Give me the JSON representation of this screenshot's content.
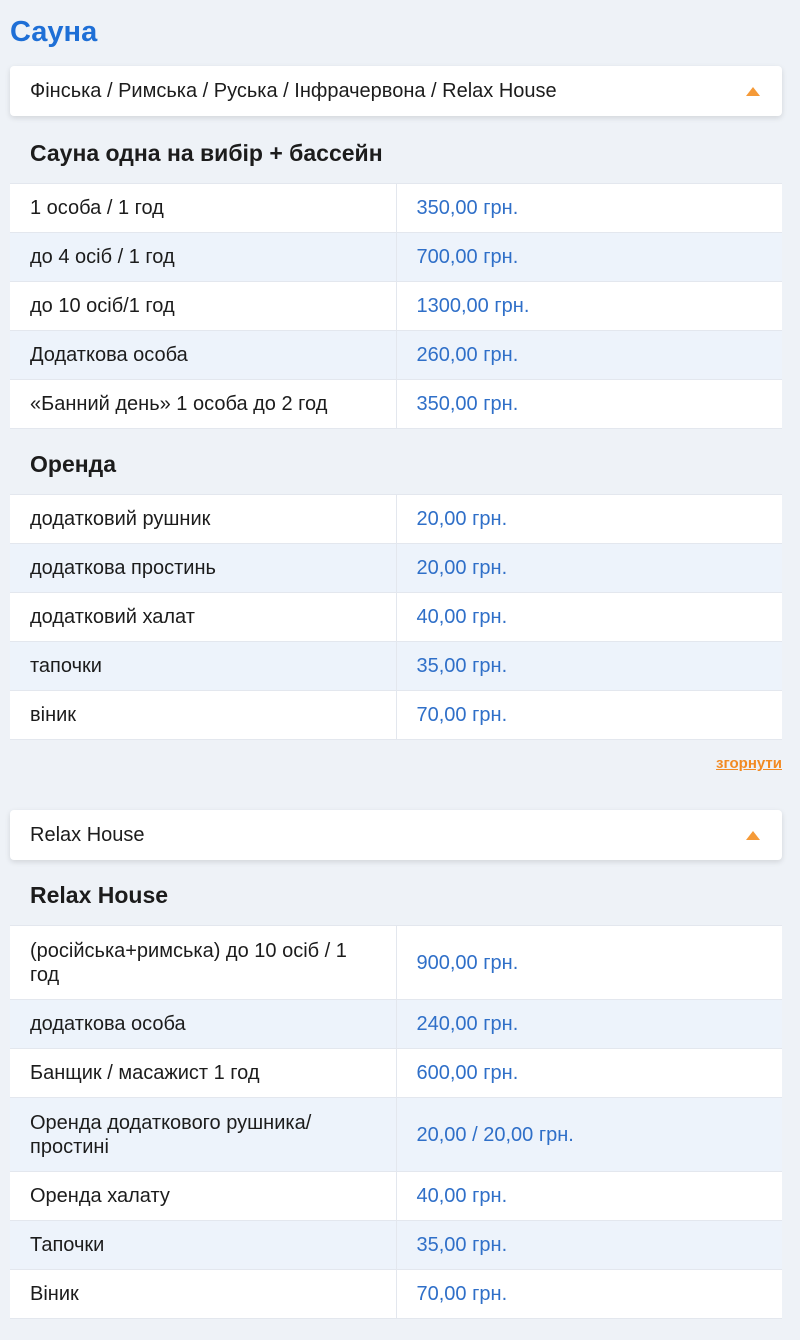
{
  "page": {
    "title": "Сауна"
  },
  "accordion1": {
    "title": "Фінська / Римська / Руська / Інфрачервона / Relax House",
    "icon": "chevron-up-icon",
    "groups": [
      {
        "heading": "Сауна одна на вибір + бассейн",
        "rows": [
          {
            "name": "1 особа / 1 год",
            "price": "350,00 грн."
          },
          {
            "name": "до 4 осіб / 1 год",
            "price": "700,00 грн."
          },
          {
            "name": "до 10 осіб/1 год",
            "price": "1300,00 грн."
          },
          {
            "name": "Додаткова особа",
            "price": "260,00 грн."
          },
          {
            "name": "«Банний день» 1 особа до 2 год",
            "price": "350,00 грн."
          }
        ]
      },
      {
        "heading": "Оренда",
        "rows": [
          {
            "name": "додатковий рушник",
            "price": "20,00 грн."
          },
          {
            "name": "додаткова простинь",
            "price": "20,00 грн."
          },
          {
            "name": "додатковий халат",
            "price": "40,00 грн."
          },
          {
            "name": "тапочки",
            "price": "35,00 грн."
          },
          {
            "name": "віник",
            "price": "70,00 грн."
          }
        ]
      }
    ],
    "collapse_label": "згорнути"
  },
  "accordion2": {
    "title": "Relax House",
    "icon": "chevron-up-icon",
    "groups": [
      {
        "heading": "Relax House",
        "rows": [
          {
            "name": "(російська+римська) до 10 осіб / 1 год",
            "price": "900,00 грн."
          },
          {
            "name": "додаткова особа",
            "price": "240,00 грн."
          },
          {
            "name": "Банщик / масажист 1 год",
            "price": "600,00 грн."
          },
          {
            "name": "Оренда додаткового рушника/ простині",
            "price": "20,00 / 20,00 грн."
          },
          {
            "name": "Оренда халату",
            "price": "40,00 грн."
          },
          {
            "name": "Тапочки",
            "price": "35,00 грн."
          },
          {
            "name": "Віник",
            "price": "70,00 грн."
          }
        ]
      }
    ]
  },
  "colors": {
    "title": "#1e6fd6",
    "price": "#2f6fc8",
    "accent": "#f59a38",
    "row_alt": "#edf3fb",
    "background": "#eef2f7"
  }
}
